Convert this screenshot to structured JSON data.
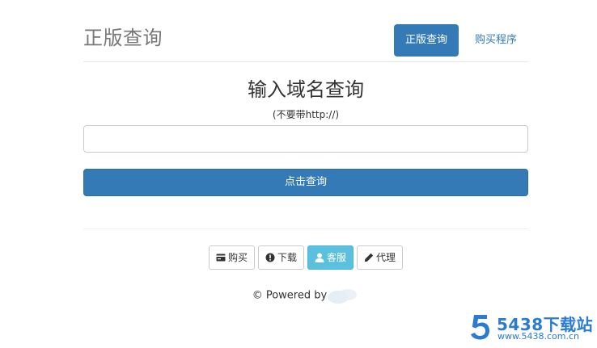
{
  "header": {
    "brand": "正版查询",
    "nav": [
      {
        "label": "正版查询",
        "active": true
      },
      {
        "label": "购买程序",
        "active": false
      }
    ]
  },
  "main": {
    "title": "输入域名查询",
    "subtitle": "(不要带http://)",
    "input_value": "",
    "input_placeholder": "",
    "query_button": "点击查询"
  },
  "footer": {
    "buttons": [
      {
        "label": "购买",
        "icon": "credit-card-icon"
      },
      {
        "label": "下载",
        "icon": "exclamation-circle-icon"
      },
      {
        "label": "客服",
        "icon": "user-icon"
      },
      {
        "label": "代理",
        "icon": "pencil-icon"
      }
    ],
    "powered": "© Powered by"
  },
  "watermark": {
    "title": "5438下载站",
    "url": "www.5438.com.cn",
    "digit": "5"
  },
  "colors": {
    "primary": "#337ab7",
    "info": "#5bc0de",
    "brand_text": "#777777",
    "watermark": "#2a7bd1"
  }
}
